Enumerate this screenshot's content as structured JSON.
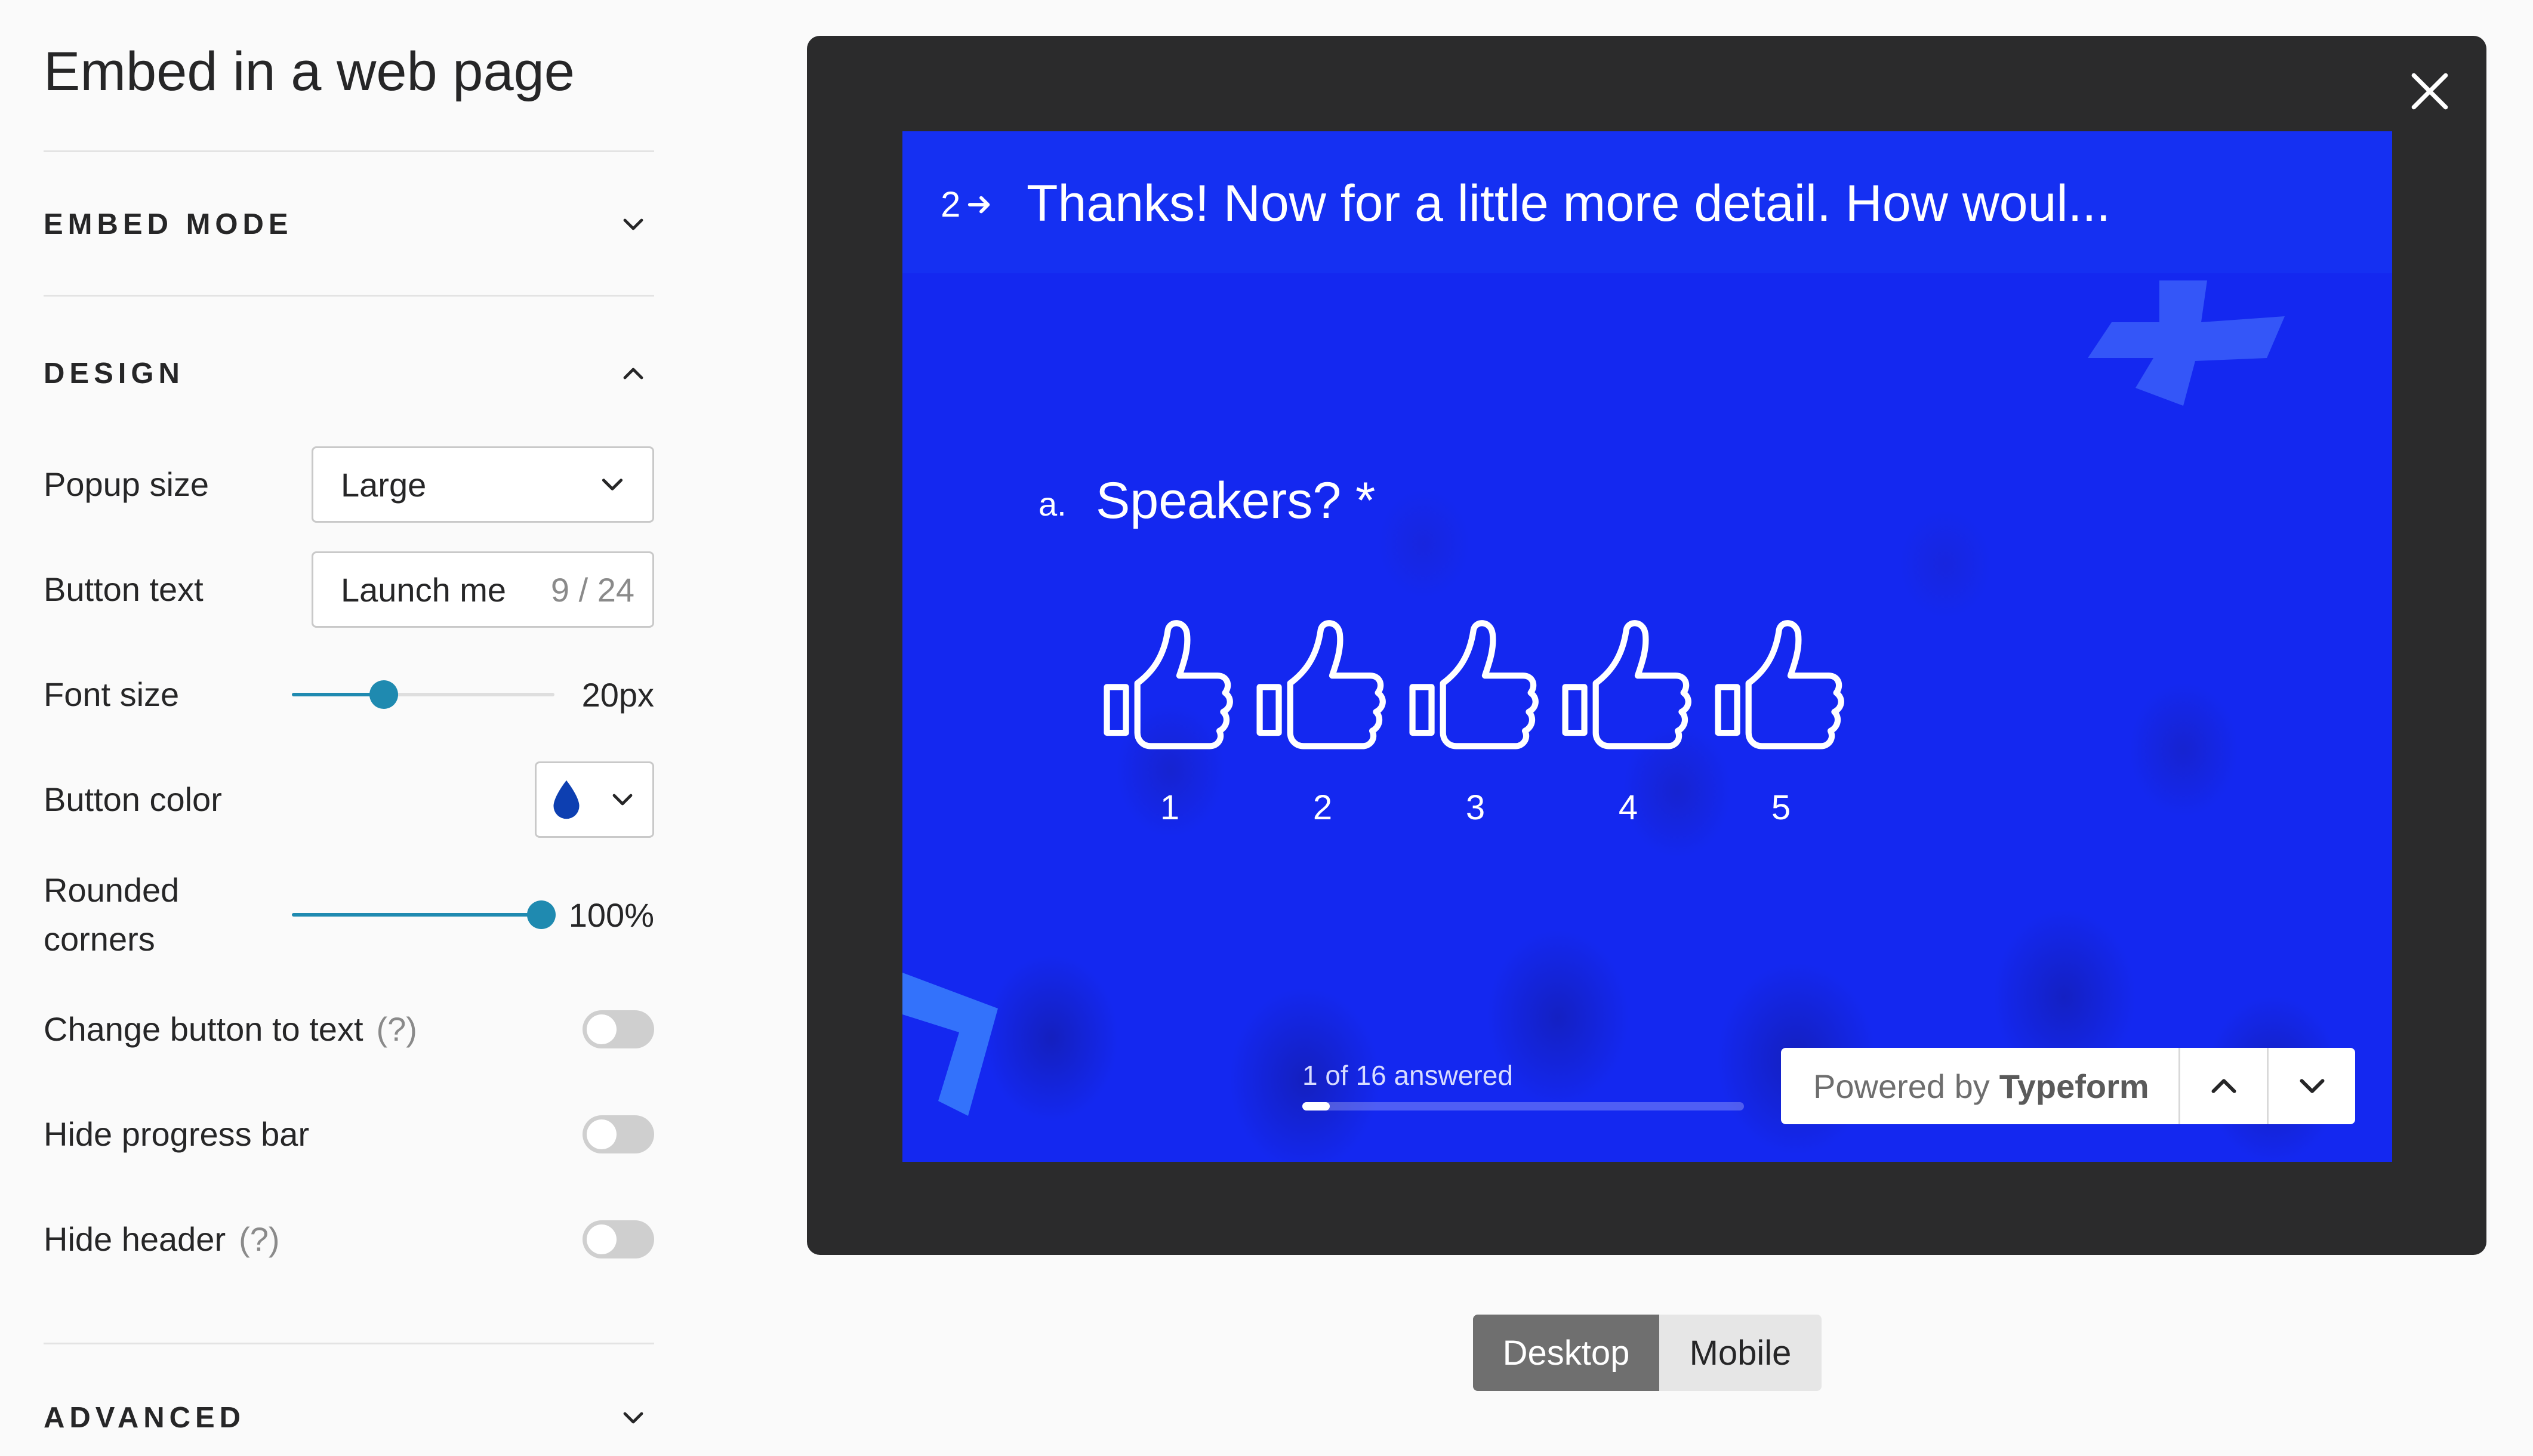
{
  "page": {
    "title": "Embed in a web page"
  },
  "sections": {
    "embed_mode": {
      "label": "EMBED MODE",
      "icon": "chevron-down-icon"
    },
    "design": {
      "label": "DESIGN",
      "icon": "chevron-up-icon"
    },
    "advanced": {
      "label": "ADVANCED",
      "icon": "chevron-down-icon"
    }
  },
  "design": {
    "popup_size": {
      "label": "Popup size",
      "value": "Large"
    },
    "button_text": {
      "label": "Button text",
      "value": "Launch me",
      "count": "9 / 24"
    },
    "font_size": {
      "label": "Font size",
      "value": "20px",
      "fraction": 0.35
    },
    "button_color": {
      "label": "Button color",
      "color": "#0d3fb1",
      "icon": "droplet-icon"
    },
    "rounded_corners": {
      "label_line1": "Rounded",
      "label_line2": "corners",
      "value": "100%",
      "fraction": 1.0
    },
    "change_button_to_text": {
      "label": "Change button to text",
      "help": "(?)",
      "on": false
    },
    "hide_progress_bar": {
      "label": "Hide progress bar",
      "on": false
    },
    "hide_header": {
      "label": "Hide header",
      "help": "(?)",
      "on": false
    }
  },
  "preview": {
    "close_icon": "close-icon",
    "question_number": "2",
    "question_title": "Thanks! Now for a little more detail. How woul...",
    "sub_letter": "a.",
    "sub_title": "Speakers? *",
    "rating": [
      "1",
      "2",
      "3",
      "4",
      "5"
    ],
    "progress_text": "1 of 16 answered",
    "progress_fraction": 0.0625,
    "powered_prefix": "Powered by",
    "powered_brand": "Typeform"
  },
  "device": {
    "desktop": "Desktop",
    "mobile": "Mobile",
    "active": "desktop"
  },
  "colors": {
    "accent": "#1f8ab0",
    "form_bg": "#1428f0",
    "preview_frame": "#2b2b2c"
  }
}
